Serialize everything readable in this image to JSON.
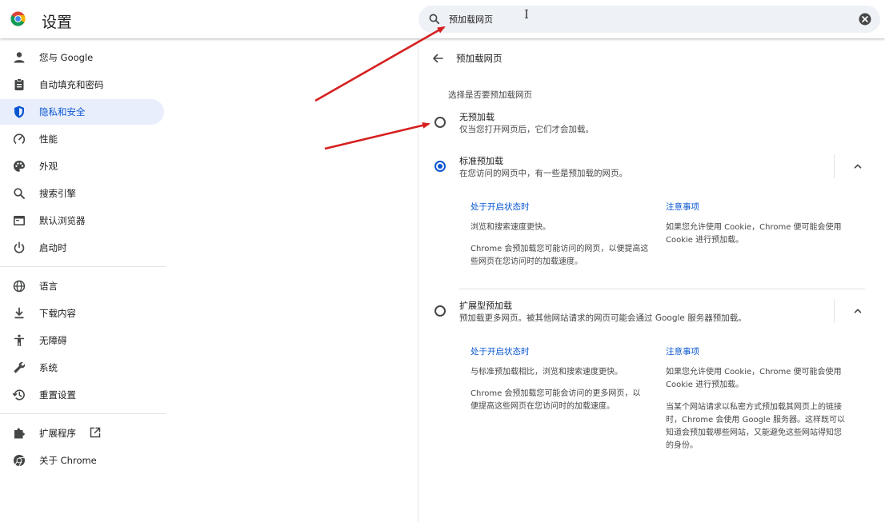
{
  "header": {
    "title": "设置",
    "search_value": "预加载网页",
    "text_cursor": "I"
  },
  "sidebar": {
    "items": [
      {
        "label": "您与 Google",
        "icon": "person-icon"
      },
      {
        "label": "自动填充和密码",
        "icon": "clipboard-icon"
      },
      {
        "label": "隐私和安全",
        "icon": "shield-icon",
        "active": true
      },
      {
        "label": "性能",
        "icon": "speedometer-icon"
      },
      {
        "label": "外观",
        "icon": "palette-icon"
      },
      {
        "label": "搜索引擎",
        "icon": "search-icon"
      },
      {
        "label": "默认浏览器",
        "icon": "browser-window-icon"
      },
      {
        "label": "启动时",
        "icon": "power-icon"
      },
      {
        "label": "语言",
        "icon": "globe-icon"
      },
      {
        "label": "下载内容",
        "icon": "download-icon"
      },
      {
        "label": "无障碍",
        "icon": "accessibility-icon"
      },
      {
        "label": "系统",
        "icon": "wrench-icon"
      },
      {
        "label": "重置设置",
        "icon": "history-icon"
      },
      {
        "label": "扩展程序",
        "icon": "puzzle-icon"
      },
      {
        "label": "关于 Chrome",
        "icon": "chrome-icon"
      }
    ]
  },
  "main": {
    "title": "预加载网页",
    "section_label": "选择是否要预加载网页",
    "options": [
      {
        "title": "无预加载",
        "description": "仅当您打开网页后，它们才会加载。",
        "checked": false
      },
      {
        "title": "标准预加载",
        "description": "在您访问的网页中，有一些是预加载的网页。",
        "checked": true,
        "details": {
          "when_on_heading": "处于开启状态时",
          "when_on_lines": [
            "浏览和搜索速度更快。",
            "Chrome 会预加载您可能访问的网页，以便提高这些网页在您访问时的加载速度。"
          ],
          "notes_heading": "注意事项",
          "notes_lines": [
            "如果您允许使用 Cookie，Chrome 便可能会使用 Cookie 进行预加载。"
          ]
        }
      },
      {
        "title": "扩展型预加载",
        "description": "预加载更多网页。被其他网站请求的网页可能会通过 Google 服务器预加载。",
        "checked": false,
        "details": {
          "when_on_heading": "处于开启状态时",
          "when_on_lines": [
            "与标准预加载相比，浏览和搜索速度更快。",
            "Chrome 会预加载您可能会访问的更多网页，以便提高这些网页在您访问时的加载速度。"
          ],
          "notes_heading": "注意事项",
          "notes_lines": [
            "如果您允许使用 Cookie，Chrome 便可能会使用 Cookie 进行预加载。",
            "当某个网站请求以私密方式预加载其网页上的链接时，Chrome 会使用 Google 服务器。这样既可以知道会预加载哪些网站，又能避免这些网站得知您的身份。"
          ]
        }
      }
    ]
  },
  "colors": {
    "accent": "#0b57d0",
    "active_bg": "#e8eefc",
    "annotation_arrow": "#d61f1f"
  }
}
